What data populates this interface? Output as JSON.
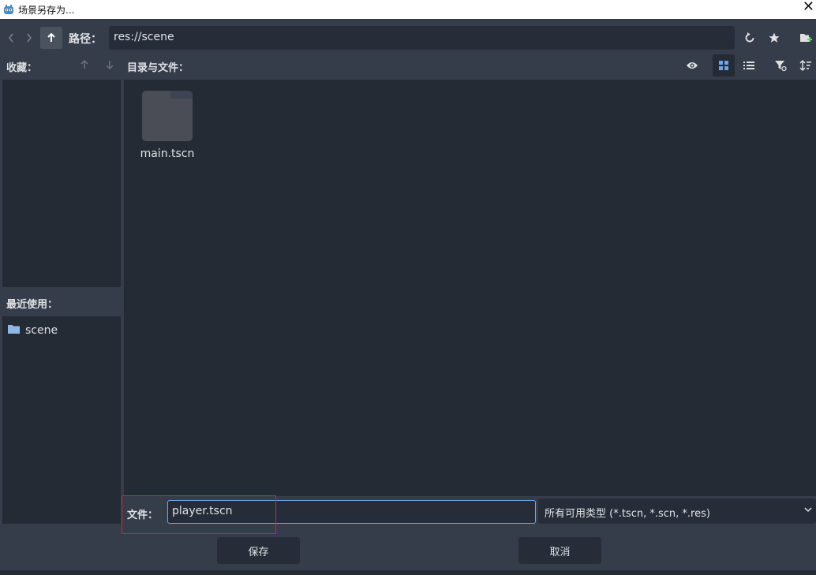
{
  "window": {
    "title": "场景另存为...",
    "close_glyph": "✕"
  },
  "toolbar": {
    "path_label": "路径：",
    "path_value": "res://scene"
  },
  "favorites": {
    "header": "收藏："
  },
  "recent": {
    "header": "最近使用：",
    "items": [
      {
        "label": "scene"
      }
    ]
  },
  "main": {
    "header": "目录与文件：",
    "files": [
      {
        "name": "main.tscn"
      }
    ]
  },
  "footer": {
    "file_label": "文件：",
    "filename_value": "player.tscn",
    "filter_selected": "所有可用类型 (*.tscn, *.scn, *.res)",
    "save_label": "保存",
    "cancel_label": "取消"
  },
  "colors": {
    "accent": "#6ba6e6",
    "highlight": "#e21f26",
    "panel": "#252b35",
    "background": "#363d4a"
  },
  "icons": [
    "godot-icon",
    "chevron-left-icon",
    "chevron-right-icon",
    "arrow-up-icon",
    "refresh-icon",
    "star-icon",
    "new-folder-icon",
    "move-up-icon",
    "move-down-icon",
    "eye-icon",
    "grid-view-icon",
    "list-view-icon",
    "filter-icon",
    "sort-icon",
    "folder-icon",
    "chevron-down-icon"
  ]
}
